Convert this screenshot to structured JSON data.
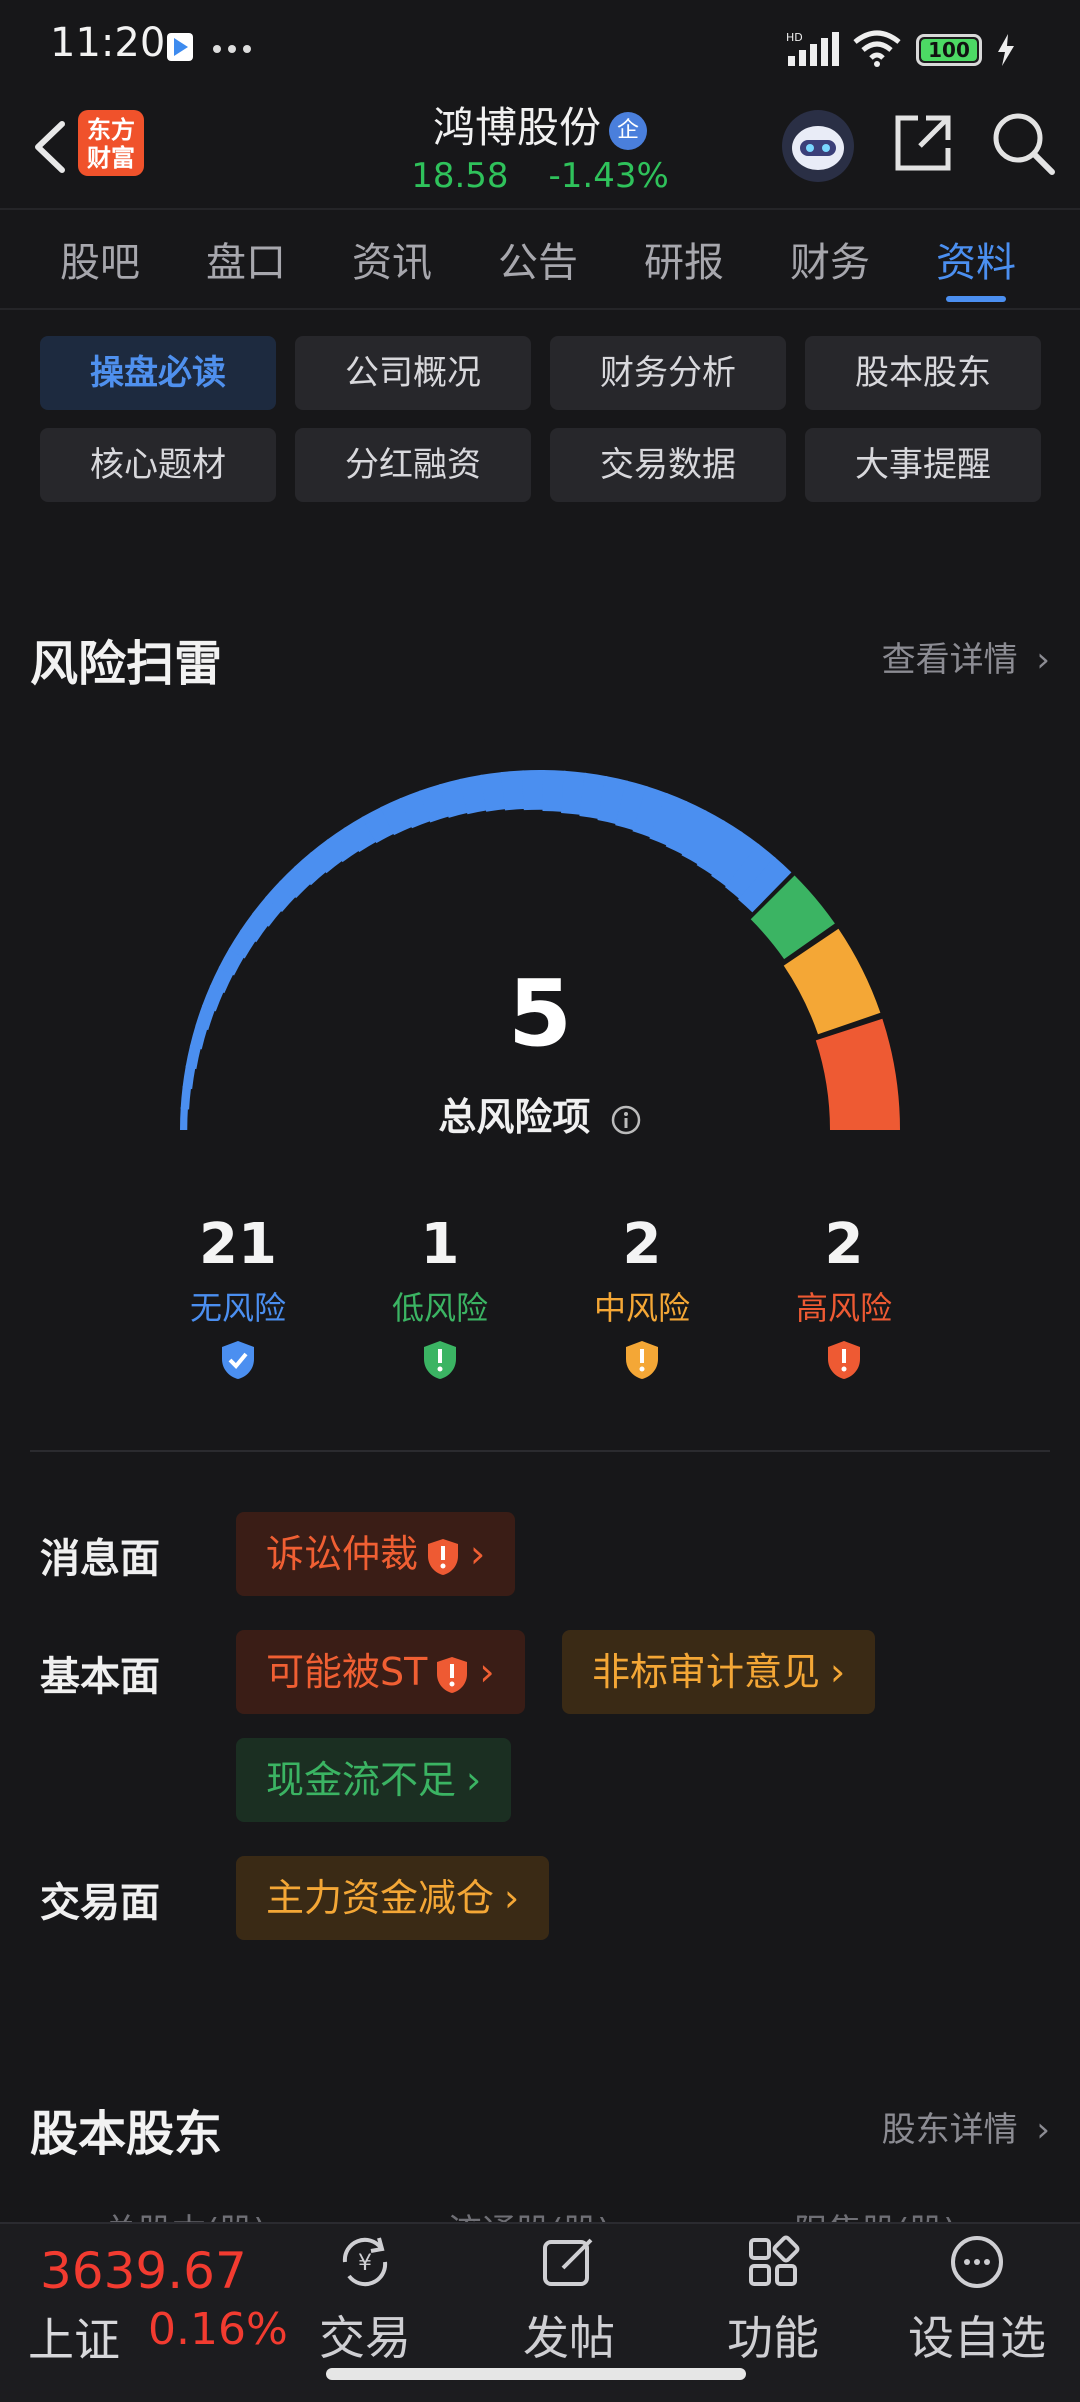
{
  "status": {
    "time": "11:20",
    "battery": "100"
  },
  "header": {
    "logo_text": "东方财富",
    "stock_name": "鸿博股份",
    "badge": "企",
    "price": "18.58",
    "change": "-1.43%"
  },
  "tabs": [
    {
      "label": "股吧"
    },
    {
      "label": "盘口"
    },
    {
      "label": "资讯"
    },
    {
      "label": "公告"
    },
    {
      "label": "研报"
    },
    {
      "label": "财务"
    },
    {
      "label": "资料",
      "active": true
    }
  ],
  "subnav": [
    {
      "label": "操盘必读",
      "active": true
    },
    {
      "label": "公司概况"
    },
    {
      "label": "财务分析"
    },
    {
      "label": "股本股东"
    },
    {
      "label": "核心题材"
    },
    {
      "label": "分红融资"
    },
    {
      "label": "交易数据"
    },
    {
      "label": "大事提醒"
    }
  ],
  "risk": {
    "title": "风险扫雷",
    "detail_link": "查看详情",
    "total": "5",
    "total_label": "总风险项",
    "stats": [
      {
        "count": "21",
        "label": "无风险",
        "color": "#4b8ff0"
      },
      {
        "count": "1",
        "label": "低风险",
        "color": "#3bb463"
      },
      {
        "count": "2",
        "label": "中风险",
        "color": "#f4a736"
      },
      {
        "count": "2",
        "label": "高风险",
        "color": "#ee5a33"
      }
    ],
    "rows": {
      "news": {
        "label": "消息面",
        "chips": [
          {
            "text": "诉讼仲裁",
            "level": "high"
          }
        ]
      },
      "fundamental": {
        "label": "基本面",
        "chips": [
          {
            "text": "可能被ST",
            "level": "high"
          },
          {
            "text": "非标审计意见",
            "level": "mid"
          },
          {
            "text": "现金流不足",
            "level": "low"
          }
        ]
      },
      "trade": {
        "label": "交易面",
        "chips": [
          {
            "text": "主力资金减仓",
            "level": "mid"
          }
        ]
      }
    }
  },
  "shareholders": {
    "title": "股本股东",
    "detail_link": "股东详情",
    "columns": [
      "总股本(股)",
      "流通股(股)",
      "限售股(股)"
    ]
  },
  "bottom": {
    "index_value": "3639.67",
    "index_name": "上证",
    "index_pct": "0.16%",
    "nav": [
      {
        "label": "交易",
        "icon": "yuan-refresh-icon"
      },
      {
        "label": "发帖",
        "icon": "edit-icon"
      },
      {
        "label": "功能",
        "icon": "grid-icon"
      },
      {
        "label": "设自选",
        "icon": "more-icon"
      }
    ]
  }
}
